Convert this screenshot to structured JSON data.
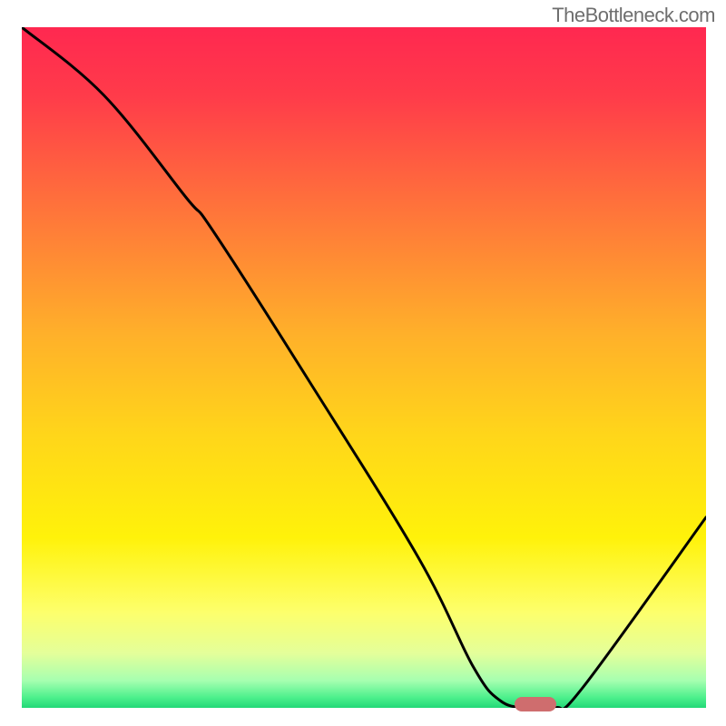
{
  "watermark": "TheBottleneck.com",
  "chart_data": {
    "type": "line",
    "title": "",
    "xlabel": "",
    "ylabel": "",
    "xlim": [
      0,
      100
    ],
    "ylim": [
      0,
      100
    ],
    "grid": false,
    "legend": false,
    "axes_visible": false,
    "background_gradient": {
      "stops": [
        {
          "offset": 0.0,
          "color": "#ff2850"
        },
        {
          "offset": 0.1,
          "color": "#ff3b4a"
        },
        {
          "offset": 0.25,
          "color": "#ff6e3c"
        },
        {
          "offset": 0.45,
          "color": "#ffb02a"
        },
        {
          "offset": 0.6,
          "color": "#ffd61a"
        },
        {
          "offset": 0.75,
          "color": "#fff20a"
        },
        {
          "offset": 0.86,
          "color": "#fdff6c"
        },
        {
          "offset": 0.92,
          "color": "#e4ff9a"
        },
        {
          "offset": 0.96,
          "color": "#a6ffb0"
        },
        {
          "offset": 0.985,
          "color": "#4cf08c"
        },
        {
          "offset": 1.0,
          "color": "#22d877"
        }
      ]
    },
    "series": [
      {
        "name": "bottleneck-curve",
        "color": "#000000",
        "x": [
          0,
          12,
          24,
          28,
          42,
          58,
          66,
          70,
          74,
          78,
          82,
          100
        ],
        "y": [
          100,
          90,
          75,
          70,
          48,
          22,
          6,
          1,
          0,
          0,
          3,
          28
        ]
      }
    ],
    "marker": {
      "name": "optimal-point",
      "x": 75,
      "y": 0,
      "color": "#cf6d6e"
    }
  }
}
